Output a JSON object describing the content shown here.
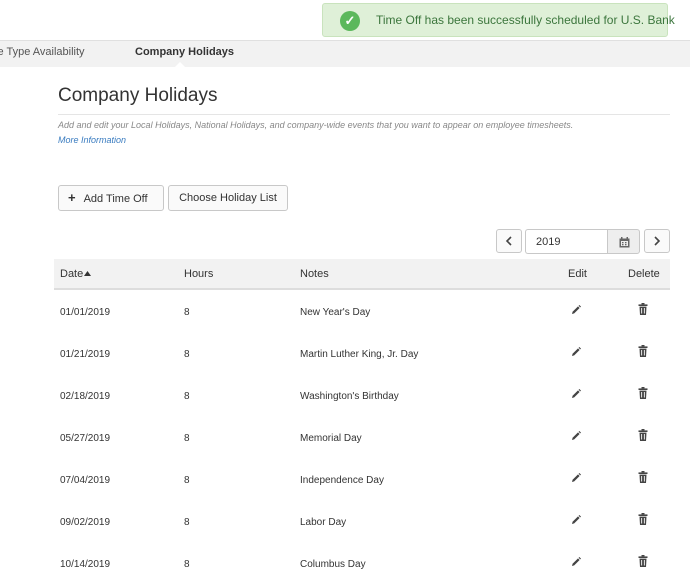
{
  "toast": {
    "icon": "check-circle-icon",
    "message": "Time Off has been successfully scheduled for U.S. Bank",
    "color": "#dff0d8"
  },
  "tabs": [
    {
      "label": "ve Type Availability"
    },
    {
      "label": "Company Holidays",
      "active": true
    }
  ],
  "page": {
    "title": "Company Holidays",
    "description": "Add and edit your Local Holidays, National Holidays, and company-wide events that you want to appear on employee timesheets.",
    "more_info": "More Information"
  },
  "actions": {
    "add_label": "Add Time Off",
    "choose_label": "Choose Holiday List"
  },
  "year_picker": {
    "value": "2019",
    "prev_icon": "chevron-left-icon",
    "next_icon": "chevron-right-icon",
    "calendar_icon": "calendar-icon"
  },
  "table": {
    "headers": {
      "date": "Date",
      "hours": "Hours",
      "notes": "Notes",
      "edit": "Edit",
      "delete": "Delete"
    },
    "sort": "Date ascending",
    "rows": [
      {
        "date": "01/01/2019",
        "hours": "8",
        "notes": "New Year's Day"
      },
      {
        "date": "01/21/2019",
        "hours": "8",
        "notes": "Martin Luther King, Jr. Day"
      },
      {
        "date": "02/18/2019",
        "hours": "8",
        "notes": "Washington's Birthday"
      },
      {
        "date": "05/27/2019",
        "hours": "8",
        "notes": "Memorial Day"
      },
      {
        "date": "07/04/2019",
        "hours": "8",
        "notes": "Independence Day"
      },
      {
        "date": "09/02/2019",
        "hours": "8",
        "notes": "Labor Day"
      },
      {
        "date": "10/14/2019",
        "hours": "8",
        "notes": "Columbus Day"
      }
    ]
  }
}
